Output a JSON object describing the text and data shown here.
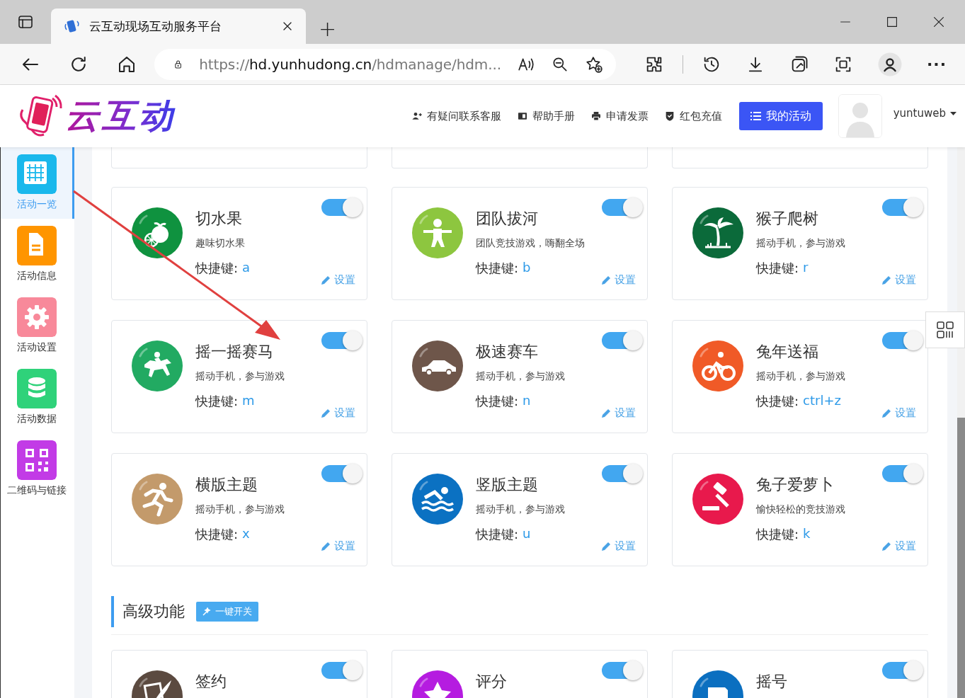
{
  "browser": {
    "tab_title": "云互动现场互动服务平台",
    "new_tab": "+",
    "address": {
      "scheme": "https://",
      "host": "hd.yunhudong.cn",
      "path": "/hdmanage/hdm..."
    },
    "more": "···"
  },
  "header": {
    "logo_text": "云互动",
    "links": [
      "有疑问联系客服",
      "帮助手册",
      "申请发票",
      "红包充值"
    ],
    "primary_button": "我的活动",
    "user": "yuntuweb"
  },
  "sidebar": {
    "items": [
      {
        "label": "活动一览",
        "color": "#1ab8ec",
        "selected": true
      },
      {
        "label": "活动信息",
        "color": "#ff9500",
        "selected": false
      },
      {
        "label": "活动设置",
        "color": "#f8899a",
        "selected": false
      },
      {
        "label": "活动数据",
        "color": "#2fd27a",
        "selected": false
      },
      {
        "label": "二维码与链接",
        "color": "#c23be6",
        "selected": false
      }
    ]
  },
  "grid": {
    "cards": [
      {
        "title": "切水果",
        "desc": "趣味切水果",
        "shortcut_label": "快捷键:",
        "shortcut": "a",
        "setting": "设置",
        "on": true,
        "kind": "fruit",
        "color": "#0f923f"
      },
      {
        "title": "团队拔河",
        "desc": "团队竞技游戏，嗨翻全场",
        "shortcut_label": "快捷键:",
        "shortcut": "b",
        "setting": "设置",
        "on": true,
        "kind": "tug",
        "color": "#8dc63f"
      },
      {
        "title": "猴子爬树",
        "desc": "摇动手机，参与游戏",
        "shortcut_label": "快捷键:",
        "shortcut": "r",
        "setting": "设置",
        "on": true,
        "kind": "palm",
        "color": "#0b6a3a"
      },
      {
        "title": "摇一摇赛马",
        "desc": "摇动手机，参与游戏",
        "shortcut_label": "快捷键:",
        "shortcut": "m",
        "setting": "设置",
        "on": true,
        "kind": "horse",
        "color": "#22aa62"
      },
      {
        "title": "极速赛车",
        "desc": "摇动手机，参与游戏",
        "shortcut_label": "快捷键:",
        "shortcut": "n",
        "setting": "设置",
        "on": true,
        "kind": "car",
        "color": "#6e564a"
      },
      {
        "title": "兔年送福",
        "desc": "摇动手机，参与游戏",
        "shortcut_label": "快捷键:",
        "shortcut": "ctrl+z",
        "setting": "设置",
        "on": true,
        "kind": "bike",
        "color": "#f05a27"
      },
      {
        "title": "横版主题",
        "desc": "摇动手机，参与游戏",
        "shortcut_label": "快捷键:",
        "shortcut": "x",
        "setting": "设置",
        "on": true,
        "kind": "runner",
        "color": "#c39a6b"
      },
      {
        "title": "竖版主题",
        "desc": "摇动手机，参与游戏",
        "shortcut_label": "快捷键:",
        "shortcut": "u",
        "setting": "设置",
        "on": true,
        "kind": "swim",
        "color": "#0b71c2"
      },
      {
        "title": "兔子爱萝卜",
        "desc": "愉快轻松的竞技游戏",
        "shortcut_label": "快捷键:",
        "shortcut": "k",
        "setting": "设置",
        "on": true,
        "kind": "gavel",
        "color": "#e8194c"
      }
    ]
  },
  "advanced": {
    "title": "高级功能",
    "button": "一键开关",
    "cards": [
      {
        "title": "签约",
        "on": true,
        "kind": "sign",
        "color": "#5b4a40"
      },
      {
        "title": "评分",
        "on": true,
        "kind": "star",
        "color": "#b51ce0"
      },
      {
        "title": "摇号",
        "on": true,
        "kind": "lottery",
        "color": "#0b6fc0"
      }
    ]
  }
}
